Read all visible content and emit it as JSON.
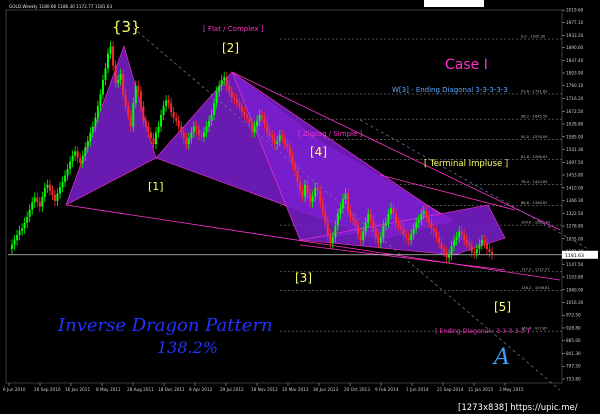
{
  "header": {
    "symbol_line": "GOLD,Weekly  1180.66  1186.30  1172.77  1181.63",
    "watermark": "[1273x838] https://upic.me/"
  },
  "colors": {
    "background": "#000000",
    "candle_up": "#00ff00",
    "candle_down": "#ff2b2b",
    "pattern_fill": "#7a1fd0",
    "pattern_line": "#ff33cc",
    "label_yellow": "#ffff66",
    "label_pink": "#ff33cc",
    "label_red": "#ff3030",
    "label_blue": "#5aa8ff",
    "fib_text": "#bbbbbb"
  },
  "annotations": {
    "wave3_braced": "{3}",
    "wave1": "[1]",
    "wave2": "[2]",
    "wave3": "[3]",
    "wave4": "[4]",
    "wave5": "[5]",
    "flat_complex": "[ Flat / Complex ]",
    "zigzag_simple": "[ Zigzag / Simple ]",
    "case": "Case I",
    "ending_diagonal_top": "W[3] - Ending Diagonal 3-3-3-3-3",
    "terminal_impulse": "[ Terminal Impluse ]",
    "ending_diagonal_bottom": "[ Ending Diagonal : 3-3-3-3-3 ]",
    "pattern_name": "Inverse Dragon Pattern",
    "pattern_ratio": "138.2%",
    "script_a": "A"
  },
  "chart_data": {
    "type": "candlestick",
    "title": "GOLD, Weekly",
    "ohlc_last": {
      "open": 1180.66,
      "high": 1186.3,
      "low": 1172.77,
      "close": 1181.63
    },
    "price_axis": {
      "min": 740,
      "max": 2020,
      "ticks": [
        2019.6,
        1977.1,
        1933.2,
        1890.6,
        1847.4,
        1803.9,
        1760.1,
        1716.2,
        1672.5,
        1628.8,
        1585.0,
        1541.3,
        1497.5,
        1453.8,
        1410.0,
        1366.3,
        1322.5,
        1278.8,
        1235.0,
        1191.3,
        1147.5,
        1103.8,
        1060.0,
        1016.3,
        972.5,
        928.8,
        885.0,
        841.3,
        797.5,
        753.8
      ]
    },
    "current_price": "1181.63",
    "x_axis_labels": [
      "6 Jun 2010",
      "26 Sep 2010",
      "16 Jan 2011",
      "8 May 2011",
      "28 Aug 2011",
      "18 Dec 2011",
      "8 Apr 2012",
      "29 Jul 2012",
      "18 Nov 2012",
      "10 Mar 2013",
      "30 Jun 2013",
      "20 Oct 2013",
      "9 Feb 2014",
      "1 Jun 2014",
      "21 Sep 2014",
      "11 Jan 2015",
      "3 May 2015"
    ],
    "fib_levels": [
      {
        "label": "0.0 - 1920.30",
        "price": 1920.3
      },
      {
        "label": "23.6 - 1731.83",
        "price": 1731.83
      },
      {
        "label": "38.2 - 1645.55",
        "price": 1645.55
      },
      {
        "label": "50.0 - 1576.09",
        "price": 1576.09
      },
      {
        "label": "61.8 - 1506.61",
        "price": 1506.61
      },
      {
        "label": "76.4 - 1420.63",
        "price": 1420.63
      },
      {
        "label": "88.6 - 1348.81",
        "price": 1348.81
      },
      {
        "label": "100.0 - 1281.70",
        "price": 1281.7
      },
      {
        "label": "127.2 - 1121.57",
        "price": 1121.57
      },
      {
        "label": "138.2 - 1056.81",
        "price": 1056.81
      },
      {
        "label": "161.8 - 917.87",
        "price": 917.87
      }
    ],
    "waves": [
      {
        "price": 1920.3,
        "label": "{3}"
      },
      {
        "price": 1522,
        "label": "[1]"
      },
      {
        "price": 1795,
        "label": "[2]"
      },
      {
        "price": 1180,
        "label": "[3]"
      },
      {
        "price": 1433,
        "label": "[4]"
      },
      {
        "price": 1056.81,
        "label": "[5]"
      }
    ],
    "series_close": [
      1215,
      1230,
      1248,
      1262,
      1270,
      1290,
      1310,
      1335,
      1360,
      1376,
      1362,
      1345,
      1378,
      1410,
      1420,
      1400,
      1386,
      1365,
      1390,
      1412,
      1430,
      1452,
      1474,
      1500,
      1520,
      1535,
      1512,
      1495,
      1520,
      1548,
      1570,
      1600,
      1620,
      1650,
      1690,
      1730,
      1780,
      1820,
      1870,
      1895,
      1830,
      1770,
      1780,
      1800,
      1730,
      1690,
      1660,
      1620,
      1700,
      1760,
      1740,
      1690,
      1640,
      1620,
      1600,
      1580,
      1560,
      1600,
      1620,
      1660,
      1690,
      1710,
      1700,
      1670,
      1650,
      1640,
      1620,
      1600,
      1580,
      1560,
      1580,
      1600,
      1620,
      1610,
      1590,
      1585,
      1600,
      1620,
      1640,
      1660,
      1700,
      1740,
      1760,
      1780,
      1790,
      1760,
      1740,
      1720,
      1715,
      1700,
      1690,
      1670,
      1660,
      1650,
      1630,
      1600,
      1620,
      1640,
      1660,
      1650,
      1630,
      1600,
      1590,
      1580,
      1560,
      1570,
      1590,
      1580,
      1560,
      1550,
      1520,
      1490,
      1470,
      1430,
      1400,
      1380,
      1420,
      1390,
      1360,
      1380,
      1410,
      1400,
      1360,
      1330,
      1290,
      1250,
      1220,
      1240,
      1280,
      1320,
      1340,
      1370,
      1390,
      1330,
      1310,
      1300,
      1280,
      1250,
      1230,
      1260,
      1290,
      1320,
      1300,
      1270,
      1240,
      1220,
      1240,
      1280,
      1290,
      1320,
      1340,
      1320,
      1290,
      1280,
      1270,
      1250,
      1240,
      1230,
      1250,
      1270,
      1290,
      1300,
      1320,
      1330,
      1310,
      1290,
      1270,
      1260,
      1240,
      1220,
      1200,
      1190,
      1170,
      1180,
      1210,
      1230,
      1240,
      1260,
      1250,
      1230,
      1220,
      1210,
      1190,
      1185,
      1200,
      1215,
      1230,
      1220,
      1200,
      1190,
      1182
    ]
  }
}
